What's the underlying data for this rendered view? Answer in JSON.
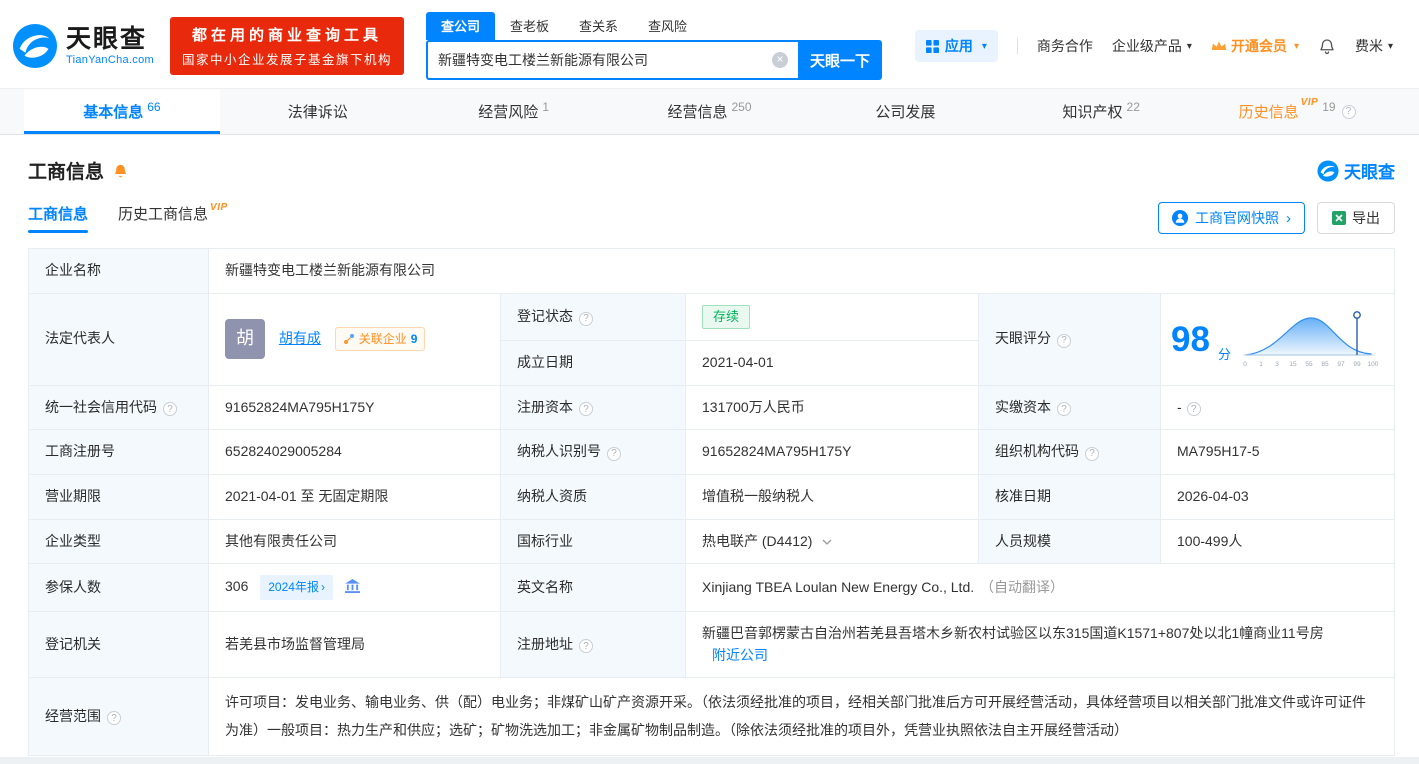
{
  "colors": {
    "primary_blue": "#0084ff",
    "brand_red": "#e8290c",
    "vip_orange": "#ff9021",
    "status_green": "#00b45a"
  },
  "header": {
    "logo": {
      "title": "天眼查",
      "subtitle": "TianYanCha.com"
    },
    "banner": {
      "line1": "都在用的商业查询工具",
      "line2": "国家中小企业发展子基金旗下机构"
    },
    "search": {
      "tabs": [
        {
          "label": "查公司"
        },
        {
          "label": "查老板"
        },
        {
          "label": "查关系"
        },
        {
          "label": "查风险"
        }
      ],
      "value": "新疆特变电工楼兰新能源有限公司",
      "button": "天眼一下"
    },
    "nav": {
      "apps": "应用",
      "cooperation": "商务合作",
      "enterprise": "企业级产品",
      "vip": "开通会员",
      "user": "费米"
    }
  },
  "tabs": [
    {
      "label": "基本信息",
      "count": "66"
    },
    {
      "label": "法律诉讼",
      "count": ""
    },
    {
      "label": "经营风险",
      "count": "1"
    },
    {
      "label": "经营信息",
      "count": "250"
    },
    {
      "label": "公司发展",
      "count": ""
    },
    {
      "label": "知识产权",
      "count": "22"
    },
    {
      "label": "历史信息",
      "count": "19",
      "vip": "VIP"
    }
  ],
  "section": {
    "title": "工商信息",
    "brand": "天眼查",
    "subtabs": [
      {
        "label": "工商信息"
      },
      {
        "label": "历史工商信息",
        "vip": "VIP"
      }
    ],
    "snapshot_button": "工商官网快照",
    "export_button": "导出"
  },
  "biz": {
    "company_name": {
      "label": "企业名称",
      "value": "新疆特变电工楼兰新能源有限公司"
    },
    "legal_rep": {
      "label": "法定代表人",
      "avatar": "胡",
      "name": "胡有成",
      "badge": "关联企业",
      "badge_count": "9"
    },
    "reg_status": {
      "label": "登记状态",
      "value": "存续"
    },
    "establish_date": {
      "label": "成立日期",
      "value": "2021-04-01"
    },
    "score": {
      "label": "天眼评分",
      "value": "98",
      "unit": "分",
      "axis": [
        "0",
        "1",
        "3",
        "15",
        "55",
        "85",
        "97",
        "99",
        "100"
      ]
    },
    "credit_code": {
      "label": "统一社会信用代码",
      "value": "91652824MA795H175Y"
    },
    "reg_capital": {
      "label": "注册资本",
      "value": "131700万人民币"
    },
    "paid_capital": {
      "label": "实缴资本",
      "value": "-"
    },
    "reg_number": {
      "label": "工商注册号",
      "value": "652824029005284"
    },
    "taxpayer_id": {
      "label": "纳税人识别号",
      "value": "91652824MA795H175Y"
    },
    "org_code": {
      "label": "组织机构代码",
      "value": "MA795H17-5"
    },
    "business_term": {
      "label": "营业期限",
      "value": "2021-04-01 至 无固定期限"
    },
    "taxpayer_quality": {
      "label": "纳税人资质",
      "value": "增值税一般纳税人"
    },
    "approval_date": {
      "label": "核准日期",
      "value": "2026-04-03"
    },
    "company_type": {
      "label": "企业类型",
      "value": "其他有限责任公司"
    },
    "industry": {
      "label": "国标行业",
      "value": "热电联产 (D4412)"
    },
    "staff_size": {
      "label": "人员规模",
      "value": "100-499人"
    },
    "insured": {
      "label": "参保人数",
      "value": "306",
      "badge": "2024年报"
    },
    "english_name": {
      "label": "英文名称",
      "value": "Xinjiang TBEA Loulan New Energy Co., Ltd.",
      "note": "（自动翻译）"
    },
    "reg_authority": {
      "label": "登记机关",
      "value": "若羌县市场监督管理局"
    },
    "reg_address": {
      "label": "注册地址",
      "value": "新疆巴音郭楞蒙古自治州若羌县吾塔木乡新农村试验区以东315国道K1571+807处以北1幢商业11号房",
      "link": "附近公司"
    },
    "business_scope": {
      "label": "经营范围",
      "value": "许可项目：发电业务、输电业务、供（配）电业务；非煤矿山矿产资源开采。（依法须经批准的项目，经相关部门批准后方可开展经营活动，具体经营项目以相关部门批准文件或许可证件为准）一般项目：热力生产和供应；选矿；矿物洗选加工；非金属矿物制品制造。（除依法须经批准的项目外，凭营业执照依法自主开展经营活动）"
    }
  }
}
